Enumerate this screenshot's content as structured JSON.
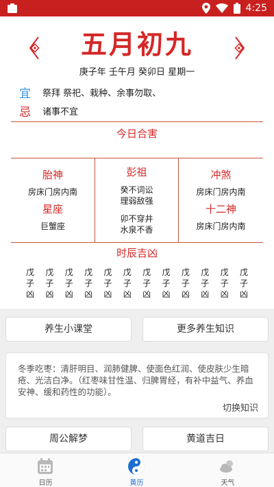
{
  "status_bar": {
    "time": "4:25"
  },
  "header": {
    "date_title": "五月初九",
    "ganzhi": "庚子年 壬午月 癸卯日 星期一"
  },
  "yi": {
    "tag": "宜",
    "text": "祭拜 祭祀、栽种、余事勿取、"
  },
  "ji": {
    "tag": "忌",
    "text": "诸事不宜"
  },
  "today_section": {
    "title": "今日合害"
  },
  "grid": {
    "taishen": {
      "title": "胎神",
      "value": "房床门房内南"
    },
    "xingzuo": {
      "title": "星座",
      "value": "巨蟹座"
    },
    "pengzu": {
      "title": "彭祖",
      "lines": [
        "癸不词讼",
        "理弱敌强",
        "卯不穿井",
        "水泉不香"
      ]
    },
    "chongsha": {
      "title": "冲煞",
      "value": "房床门房内南"
    },
    "shiershen": {
      "title": "十二神",
      "value": "房床门房内南"
    }
  },
  "hours_section": {
    "title": "时辰吉凶",
    "items": [
      {
        "top": "戊",
        "mid": "子",
        "bot": "凶"
      },
      {
        "top": "戊",
        "mid": "子",
        "bot": "凶"
      },
      {
        "top": "戊",
        "mid": "子",
        "bot": "凶"
      },
      {
        "top": "戊",
        "mid": "子",
        "bot": "凶"
      },
      {
        "top": "戊",
        "mid": "子",
        "bot": "凶"
      },
      {
        "top": "戊",
        "mid": "子",
        "bot": "凶"
      },
      {
        "top": "戊",
        "mid": "子",
        "bot": "凶"
      },
      {
        "top": "戊",
        "mid": "子",
        "bot": "凶"
      },
      {
        "top": "戊",
        "mid": "子",
        "bot": "凶"
      },
      {
        "top": "戊",
        "mid": "子",
        "bot": "凶"
      },
      {
        "top": "戊",
        "mid": "子",
        "bot": "凶"
      },
      {
        "top": "戊",
        "mid": "子",
        "bot": "凶"
      }
    ]
  },
  "health": {
    "class_button": "养生小课堂",
    "more_button": "更多养生知识",
    "knowledge_text": "冬季吃枣：清肝明目、润肺健脾、使面色红润、使皮肤少生暗疮、光洁白净。（红枣味甘性温、归脾胃经，有补中益气、养血安神、缓和药性的功能）。",
    "switch_label": "切换知识"
  },
  "bottom_buttons": {
    "dream": "周公解梦",
    "auspicious": "黄道吉日"
  },
  "tabs": [
    {
      "label": "日历",
      "icon": "calendar-icon"
    },
    {
      "label": "黄历",
      "icon": "yin-yang-icon"
    },
    {
      "label": "天气",
      "icon": "weather-icon"
    }
  ],
  "colors": {
    "accent_red": "#d42727",
    "status_red": "#c8201f",
    "yi_blue": "#3b94d9",
    "tab_active": "#1f6fd0"
  }
}
